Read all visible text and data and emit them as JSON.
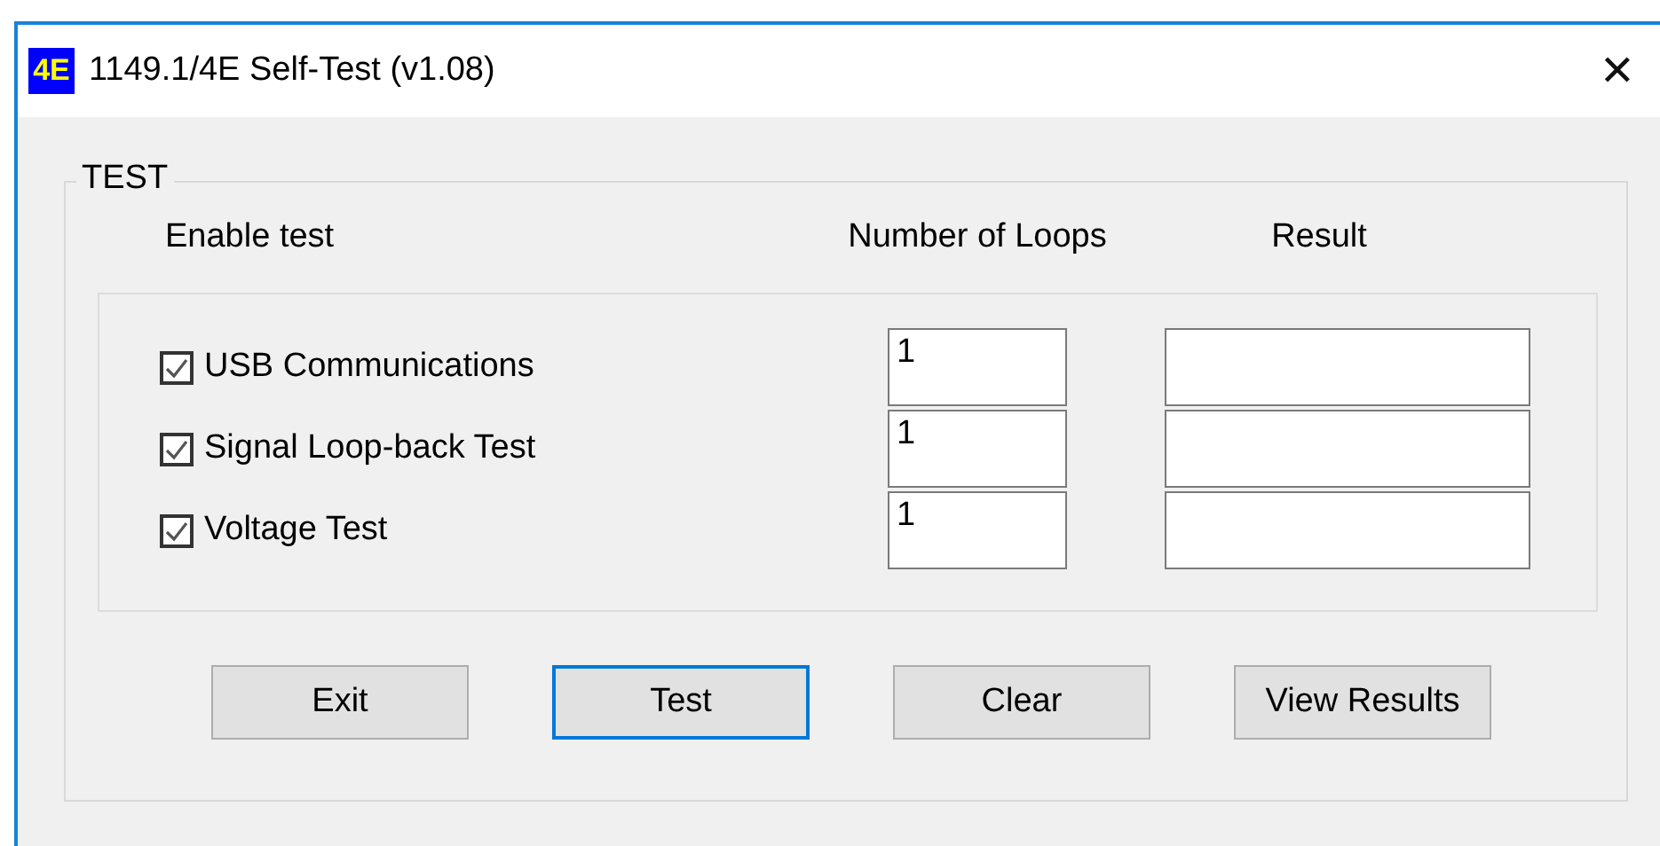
{
  "window": {
    "icon_text": "4E",
    "title": "1149.1/4E Self-Test (v1.08)",
    "close": "✕"
  },
  "group": {
    "title": "TEST",
    "headers": [
      "Enable test",
      "Number of Loops",
      "Result"
    ],
    "tests": [
      {
        "label": "USB Communications",
        "checked": true,
        "loops": "1"
      },
      {
        "label": "Signal Loop-back Test",
        "checked": true,
        "loops": "1"
      },
      {
        "label": "Voltage Test",
        "checked": true,
        "loops": "1"
      }
    ]
  },
  "buttons": [
    {
      "label": "Exit",
      "focused": false
    },
    {
      "label": "Test",
      "focused": true
    },
    {
      "label": "Clear",
      "focused": false
    },
    {
      "label": "View Results",
      "focused": false
    }
  ]
}
